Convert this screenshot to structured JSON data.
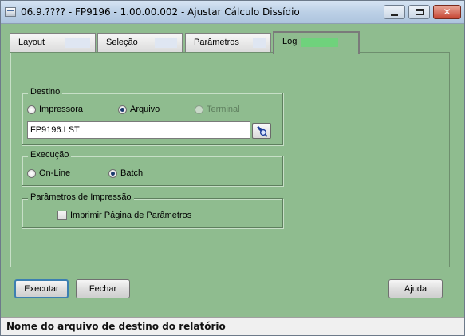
{
  "window": {
    "title": "06.9.???? - FP9196 - 1.00.00.002 - Ajustar Cálculo Dissídio",
    "minimize_icon": "minimize-icon",
    "maximize_icon": "maximize-icon",
    "close_icon": "close-icon",
    "close_glyph": "✕"
  },
  "tabs": [
    {
      "label": "Layout",
      "active": false
    },
    {
      "label": "Seleção",
      "active": false
    },
    {
      "label": "Parâmetros",
      "active": false
    },
    {
      "label": "Log",
      "active": true
    }
  ],
  "destino": {
    "legend": "Destino",
    "options": [
      {
        "label": "Impressora",
        "selected": false,
        "enabled": true
      },
      {
        "label": "Arquivo",
        "selected": true,
        "enabled": true
      },
      {
        "label": "Terminal",
        "selected": false,
        "enabled": false
      }
    ],
    "file_value": "FP9196.LST",
    "browse_icon": "flashlight-search-icon"
  },
  "execucao": {
    "legend": "Execução",
    "options": [
      {
        "label": "On-Line",
        "selected": false
      },
      {
        "label": "Batch",
        "selected": true
      }
    ]
  },
  "impressao": {
    "legend": "Parâmetros de Impressão",
    "checkbox_label": "Imprimir Página de Parâmetros",
    "checked": false
  },
  "buttons": {
    "executar": "Executar",
    "fechar": "Fechar",
    "ajuda": "Ajuda"
  },
  "status": {
    "text": "Nome do arquivo de destino do relatório"
  },
  "colors": {
    "panel_bg": "#8fbc8f",
    "active_tab_fill": "#6fd27c",
    "status_bg": "#f0f0f0"
  }
}
